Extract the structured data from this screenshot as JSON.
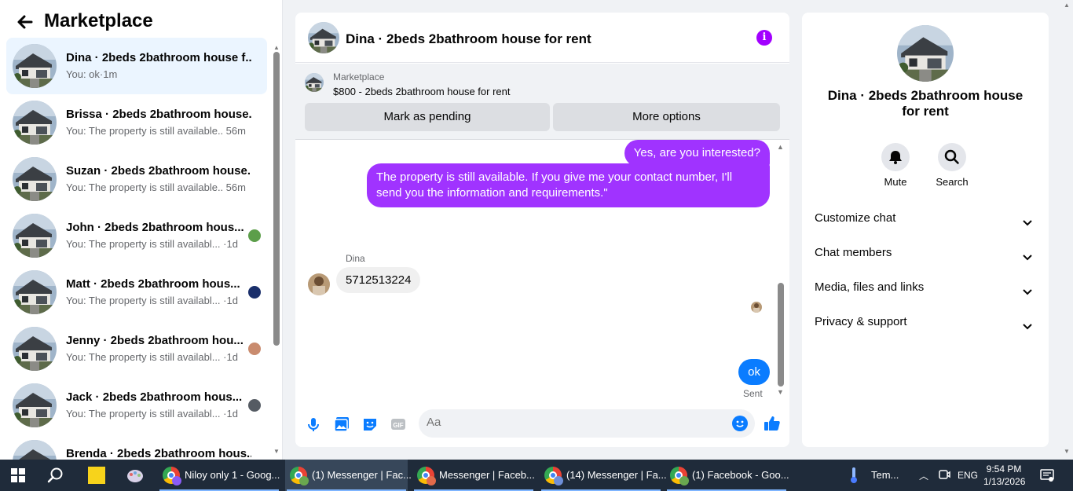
{
  "sidebar": {
    "title": "Marketplace",
    "conversations": [
      {
        "name": "Dina · 2beds 2bathroom house f...",
        "preview": "You: ok",
        "time": "1m",
        "active": true,
        "mini": null
      },
      {
        "name": "Brissa · 2beds 2bathroom house...",
        "preview": "You: The property is still available....",
        "time": "56m",
        "active": false,
        "mini": null
      },
      {
        "name": "Suzan · 2beds 2bathroom house...",
        "preview": "You: The property is still available....",
        "time": "56m",
        "active": false,
        "mini": null
      },
      {
        "name": "John · 2beds 2bathroom hous...",
        "preview": "You: The property is still availabl...",
        "time": "1d",
        "active": false,
        "mini": "#5c9e4a"
      },
      {
        "name": "Matt · 2beds 2bathroom hous...",
        "preview": "You: The property is still availabl...",
        "time": "1d",
        "active": false,
        "mini": "#1a2f6b"
      },
      {
        "name": "Jenny · 2beds 2bathroom hou...",
        "preview": "You: The property is still availabl...",
        "time": "1d",
        "active": false,
        "mini": "#c98b6e"
      },
      {
        "name": "Jack · 2beds 2bathroom hous...",
        "preview": "You: The property is still availabl...",
        "time": "1d",
        "active": false,
        "mini": "#555b63"
      },
      {
        "name": "Brenda · 2beds 2bathroom hous...",
        "preview": "",
        "time": "",
        "active": false,
        "mini": null
      }
    ]
  },
  "chat": {
    "title": "Dina · 2beds 2bathroom house for rent",
    "marketplace_label": "Marketplace",
    "listing": "$800 - 2beds 2bathroom house for rent",
    "pending_button": "Mark as pending",
    "more_button": "More options",
    "messages": {
      "out1": "Yes, are you interested?",
      "out2": "The property is still available. If you give me your contact number, I'll send you the information and requirements.\"",
      "sender": "Dina",
      "in1": "5712513224",
      "out3": "ok",
      "status": "Sent"
    },
    "composer_placeholder": "Aa"
  },
  "details": {
    "name": "Dina · 2beds 2bathroom house for rent",
    "mute_label": "Mute",
    "search_label": "Search",
    "sections": [
      "Customize chat",
      "Chat members",
      "Media, files and links",
      "Privacy & support"
    ]
  },
  "taskbar": {
    "tasks": [
      {
        "label": "Niloy only 1 - Goog...",
        "badge": "#8a5cf6",
        "active": false
      },
      {
        "label": "(1) Messenger | Fac...",
        "badge": "#6aa84f",
        "active": true
      },
      {
        "label": "Messenger | Faceb...",
        "badge": "#e26a4a",
        "active": false
      },
      {
        "label": "(14) Messenger | Fa...",
        "badge": "#6e8fd9",
        "active": false
      },
      {
        "label": "(1) Facebook - Goo...",
        "badge": "#6aa84f",
        "active": false
      }
    ],
    "weather": "Tem...",
    "language": "ENG",
    "time": "9:54 PM",
    "date": "1/13/2026"
  },
  "colors": {
    "accent": "#a033ff",
    "blue": "#0a7cff",
    "info": "#a200ff"
  }
}
